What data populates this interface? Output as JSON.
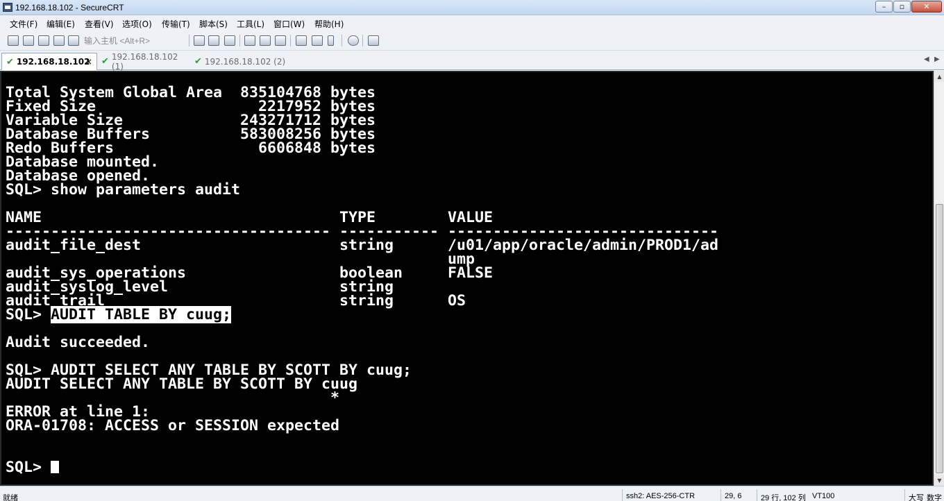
{
  "window": {
    "title": "192.168.18.102 - SecureCRT",
    "minimize": "–",
    "maximize": "▫",
    "close": "✕"
  },
  "menu": [
    "文件(F)",
    "编辑(E)",
    "查看(V)",
    "选项(O)",
    "传输(T)",
    "脚本(S)",
    "工具(L)",
    "窗口(W)",
    "帮助(H)"
  ],
  "toolbar": {
    "host_placeholder": "输入主机 <Alt+R>"
  },
  "tabs": [
    {
      "label": "192.168.18.102",
      "active": true,
      "close": "×"
    },
    {
      "label": "192.168.18.102 (1)",
      "active": false
    },
    {
      "label": "192.168.18.102 (2)",
      "active": false
    }
  ],
  "tab_nav": {
    "prev": "◀",
    "next": "▶"
  },
  "terminal": {
    "lines": [
      "Total System Global Area  835104768 bytes",
      "Fixed Size                  2217952 bytes",
      "Variable Size             243271712 bytes",
      "Database Buffers          583008256 bytes",
      "Redo Buffers                6606848 bytes",
      "Database mounted.",
      "Database opened.",
      "SQL> show parameters audit",
      "",
      "NAME                                 TYPE        VALUE",
      "------------------------------------ ----------- ------------------------------",
      "audit_file_dest                      string      /u01/app/oracle/admin/PROD1/ad",
      "                                                 ump",
      "audit_sys_operations                 boolean     FALSE",
      "audit_syslog_level                   string",
      "audit_trail                          string      OS",
      "__HL__",
      "",
      "Audit succeeded.",
      "",
      "SQL> AUDIT SELECT ANY TABLE BY SCOTT BY cuug;",
      "AUDIT SELECT ANY TABLE BY SCOTT BY cuug",
      "                                    *",
      "ERROR at line 1:",
      "ORA-01708: ACCESS or SESSION expected",
      "",
      "",
      "__CURSOR__"
    ],
    "highlight_prompt": "SQL> ",
    "highlight_text": "AUDIT TABLE BY cuug;",
    "final_prompt": "SQL> "
  },
  "statusbar": {
    "ready": "就绪",
    "cipher": "ssh2: AES-256-CTR",
    "position": "29,   6",
    "size": "29 行, 102 列",
    "emulation": "VT100",
    "caps": "大写",
    "num": "数字"
  },
  "colors": {
    "terminal_bg": "#000000",
    "terminal_fg": "#ffffff",
    "check": "#2e9e2e"
  },
  "icons": [
    "connect-icon",
    "quick-connect-icon",
    "tab-connect-icon",
    "reconnect-icon",
    "disconnect-icon",
    "copy-icon",
    "paste-icon",
    "find-icon",
    "print-icon",
    "session-options-icon",
    "global-options-icon",
    "key-icon",
    "help-icon",
    "map-icon"
  ]
}
